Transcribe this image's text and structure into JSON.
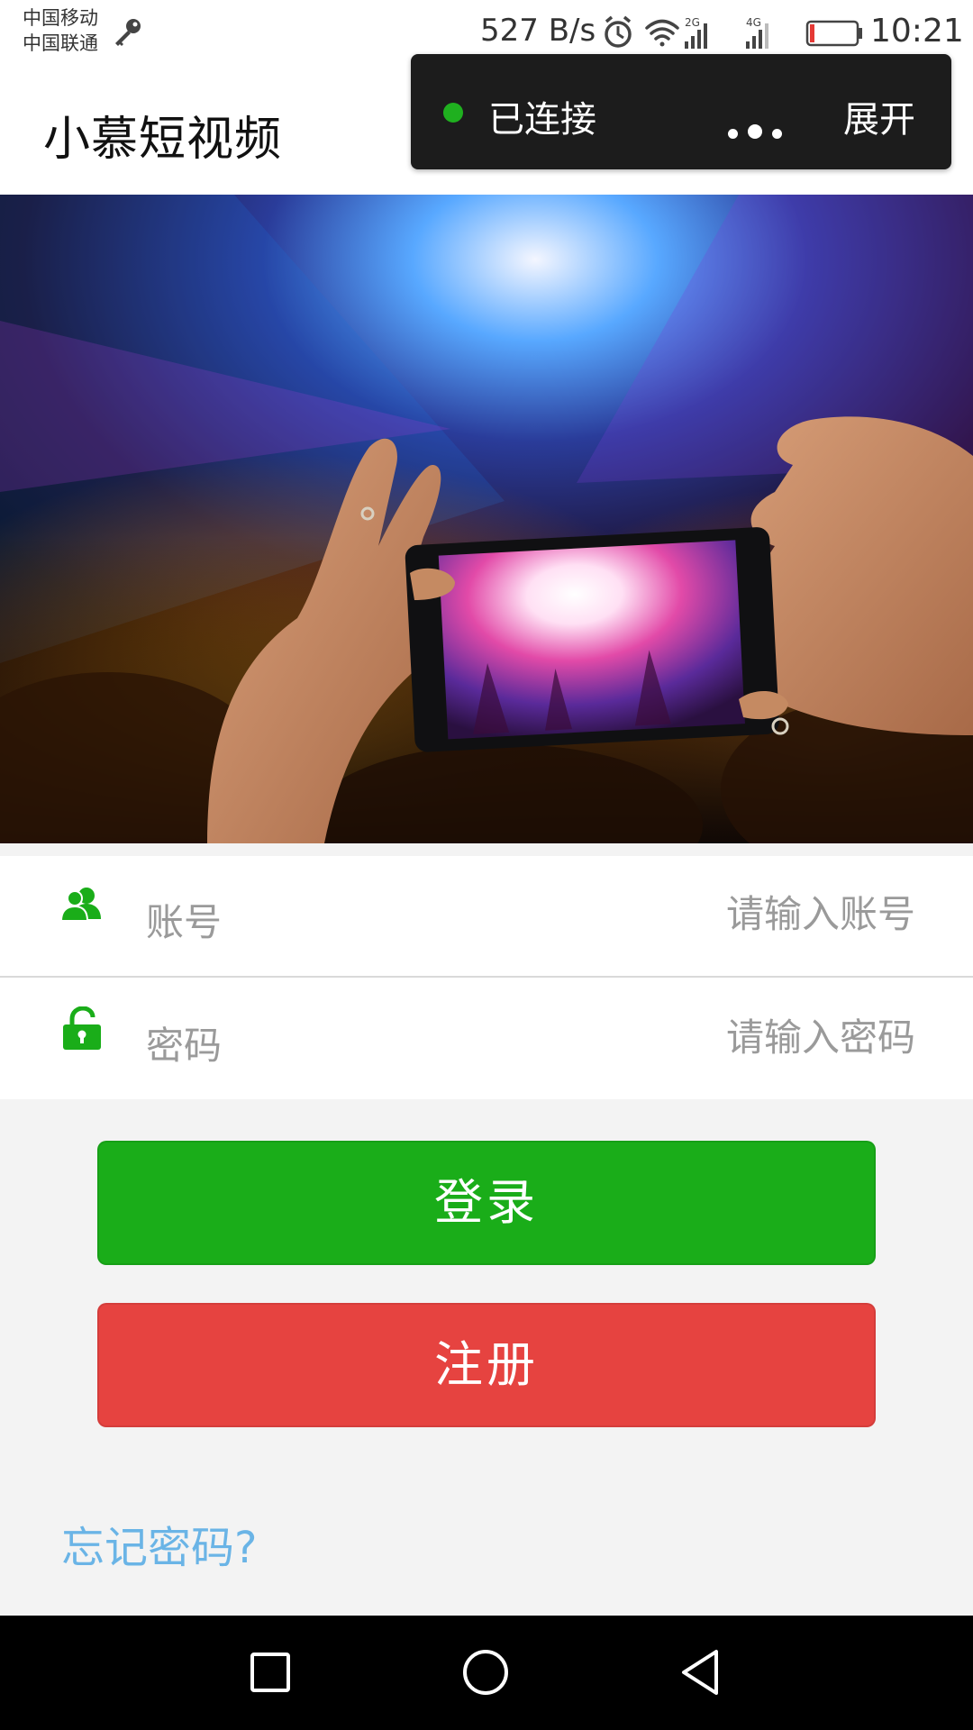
{
  "status_bar": {
    "carrier_1": "中国移动",
    "carrier_2": "中国联通",
    "net_speed": "527 B/s",
    "clock": "10:21",
    "icons": [
      "key-icon",
      "alarm-icon",
      "wifi-icon",
      "signal-2g-icon",
      "signal-4g-icon",
      "battery-low-icon"
    ],
    "network_1": "2G",
    "network_2": "4G"
  },
  "header": {
    "title": "小慕短视频"
  },
  "debug_toast": {
    "status": "已连接",
    "expand_label": "展开",
    "status_color": "#1fb01f"
  },
  "form": {
    "account": {
      "label": "账号",
      "placeholder": "请输入账号",
      "value": ""
    },
    "password": {
      "label": "密码",
      "placeholder": "请输入密码",
      "value": ""
    }
  },
  "buttons": {
    "login": "登录",
    "register": "注册"
  },
  "links": {
    "forgot_password": "忘记密码?"
  },
  "colors": {
    "login_green": "#1aad19",
    "register_red": "#e64340",
    "link_blue": "#6ab4e6",
    "icon_green": "#1aad19"
  }
}
